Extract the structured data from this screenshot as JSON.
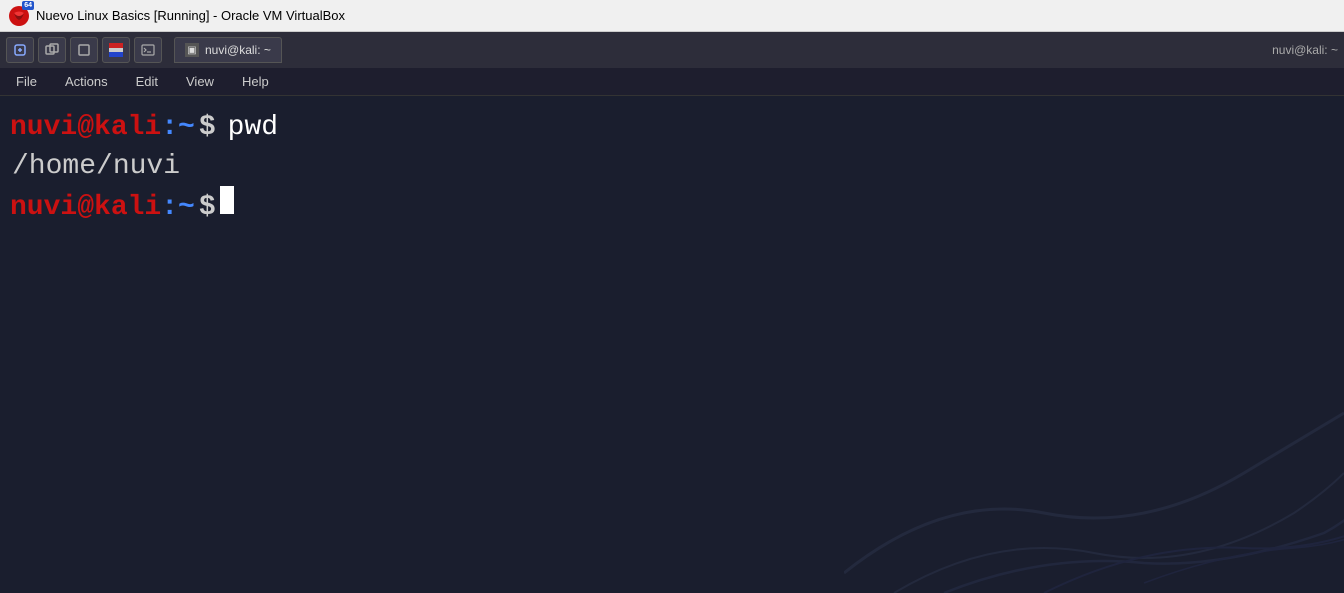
{
  "titlebar": {
    "title": "Nuevo Linux Basics [Running] - Oracle VM VirtualBox",
    "icon_label": "VirtualBox"
  },
  "toolbar": {
    "badge": "64",
    "tab_label": "nuvi@kali: ~",
    "user_info": "nuvi@kali: ~"
  },
  "menubar": {
    "items": [
      {
        "label": "File"
      },
      {
        "label": "Actions"
      },
      {
        "label": "Edit"
      },
      {
        "label": "View"
      },
      {
        "label": "Help"
      }
    ]
  },
  "terminal": {
    "line1_user": "nuvi@kali",
    "line1_tilde": ":~",
    "line1_dollar": "$",
    "line1_cmd": " pwd",
    "line2_output": "/home/nuvi",
    "line3_user": "nuvi@kali",
    "line3_tilde": ":~",
    "line3_dollar": "$"
  }
}
